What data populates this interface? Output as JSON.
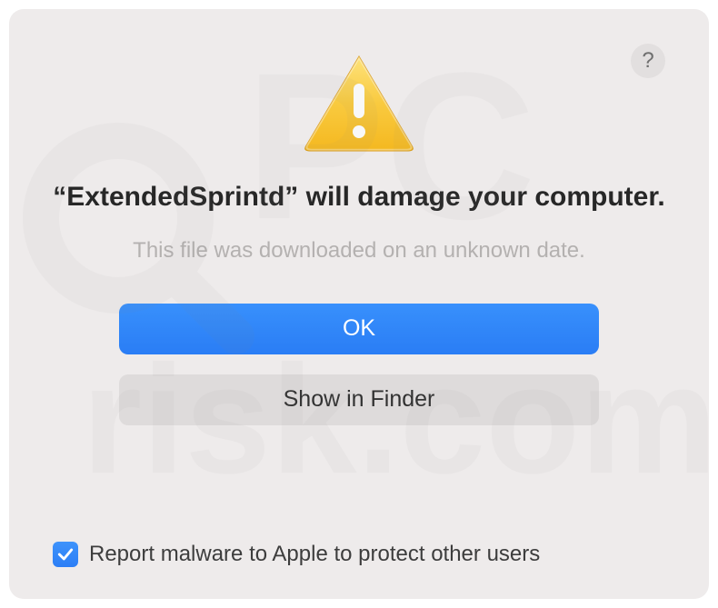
{
  "dialog": {
    "title": "“ExtendedSprintd” will damage your computer.",
    "subtitle": "This file was downloaded on an unknown date.",
    "help_label": "?",
    "buttons": {
      "ok": "OK",
      "show_in_finder": "Show in Finder"
    },
    "checkbox": {
      "checked": true,
      "label": "Report malware to Apple to protect other users"
    }
  },
  "colors": {
    "primary": "#2f82f7",
    "dialog_bg": "#eeebeb"
  }
}
